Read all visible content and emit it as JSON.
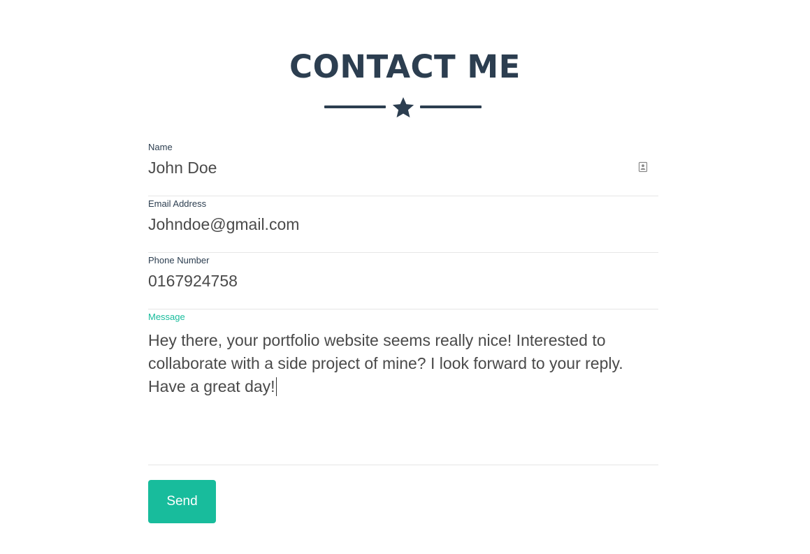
{
  "section": {
    "title": "CONTACT ME",
    "divider_icon": "star-icon"
  },
  "form": {
    "name": {
      "label": "Name",
      "value": "John Doe",
      "autofill_icon": "contact-card-icon"
    },
    "email": {
      "label": "Email Address",
      "value": "Johndoe@gmail.com"
    },
    "phone": {
      "label": "Phone Number",
      "value": "0167924758"
    },
    "message": {
      "label": "Message",
      "value": "Hey there, your portfolio website seems really nice! Interested to collaborate with a side project of mine? I look forward to your reply. Have a great day!"
    },
    "submit_label": "Send"
  },
  "colors": {
    "primary": "#2c3e50",
    "accent": "#18bc9c",
    "input_text": "#4a4a4a",
    "border": "#e6e6e6"
  }
}
